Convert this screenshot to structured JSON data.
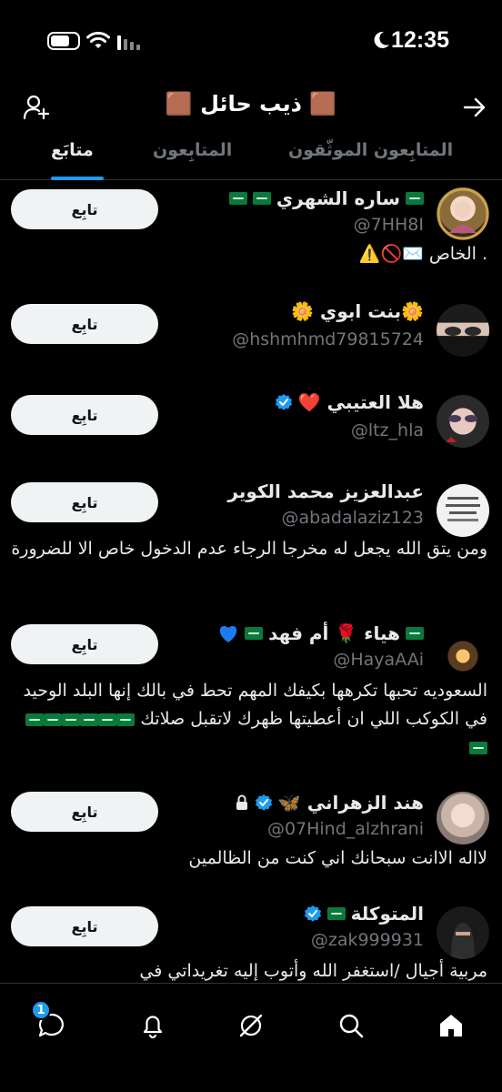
{
  "status_bar": {
    "time": "12:35",
    "battery_level": 0.7
  },
  "header": {
    "title": "🟫 ذيب حائل 🟫"
  },
  "tabs": [
    {
      "label": "المتابِعون الموثّقون",
      "active": false
    },
    {
      "label": "المتابِعون",
      "active": false
    },
    {
      "label": "متابَع",
      "active": true
    }
  ],
  "users": [
    {
      "name": "ساره الشهري",
      "handle": "@7HH8I",
      "bio": ". الخاص ✉️🚫⚠️",
      "button": "تابِع"
    },
    {
      "name": "🌼بنت ابوي 🌼",
      "handle": "@hshmhmd79815724",
      "bio": "",
      "button": "تابِع"
    },
    {
      "name": "هلا العتيبي ❤️",
      "handle": "@ltz_hla",
      "bio": "",
      "button": "تابِع"
    },
    {
      "name": "عبدالعزيز محمد الكوير",
      "handle": "@abadalaziz123",
      "bio": "ومن يتق الله يجعل له مخرجا الرجاء عدم الدخول خاص الا للضرورة",
      "button": "تابِع"
    },
    {
      "name": "هياء 🌹 أم فهد",
      "handle": "@HayaAAi",
      "bio": "السعوديه تحبها تكرهها بكيفك المهم تحط في بالك إنها البلد الوحيد في الكوكب اللي ان أعطيتها ظهرك لاتقبل صلاتك",
      "button": "تابِع"
    },
    {
      "name": "هند الزهراني 🦋",
      "handle": "@07Hind_alzhrani",
      "bio": "لااله الاانت سبحانك اني كنت من الظالمين",
      "button": "تابِع"
    },
    {
      "name": "المتوكلة",
      "handle": "@zak999931",
      "bio": "مربية أجيال /استغفر الله وأتوب إليه تغريداتي في",
      "button": "تابِع"
    }
  ],
  "bottom_nav": {
    "items": [
      "home-icon",
      "search-icon",
      "grok-icon",
      "notifications-icon",
      "messages-icon"
    ],
    "messages_badge": "1"
  },
  "colors": {
    "accent": "#1d9bf0",
    "background": "#000000",
    "muted": "#71767b"
  }
}
